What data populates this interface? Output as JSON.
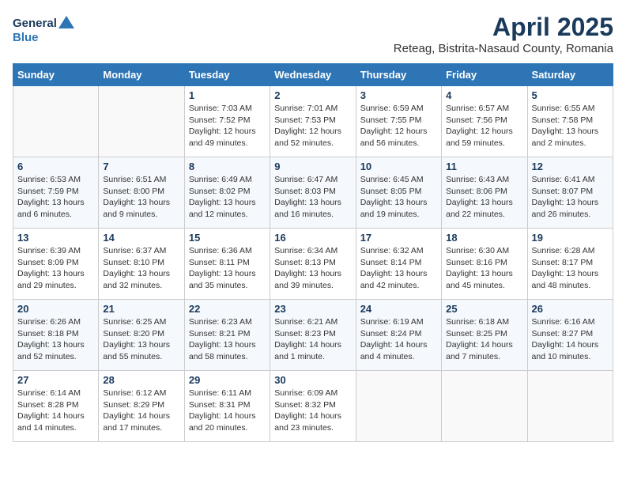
{
  "header": {
    "logo_line1": "General",
    "logo_line2": "Blue",
    "month": "April 2025",
    "location": "Reteag, Bistrita-Nasaud County, Romania"
  },
  "weekdays": [
    "Sunday",
    "Monday",
    "Tuesday",
    "Wednesday",
    "Thursday",
    "Friday",
    "Saturday"
  ],
  "weeks": [
    [
      {
        "day": "",
        "info": ""
      },
      {
        "day": "",
        "info": ""
      },
      {
        "day": "1",
        "info": "Sunrise: 7:03 AM\nSunset: 7:52 PM\nDaylight: 12 hours and 49 minutes."
      },
      {
        "day": "2",
        "info": "Sunrise: 7:01 AM\nSunset: 7:53 PM\nDaylight: 12 hours and 52 minutes."
      },
      {
        "day": "3",
        "info": "Sunrise: 6:59 AM\nSunset: 7:55 PM\nDaylight: 12 hours and 56 minutes."
      },
      {
        "day": "4",
        "info": "Sunrise: 6:57 AM\nSunset: 7:56 PM\nDaylight: 12 hours and 59 minutes."
      },
      {
        "day": "5",
        "info": "Sunrise: 6:55 AM\nSunset: 7:58 PM\nDaylight: 13 hours and 2 minutes."
      }
    ],
    [
      {
        "day": "6",
        "info": "Sunrise: 6:53 AM\nSunset: 7:59 PM\nDaylight: 13 hours and 6 minutes."
      },
      {
        "day": "7",
        "info": "Sunrise: 6:51 AM\nSunset: 8:00 PM\nDaylight: 13 hours and 9 minutes."
      },
      {
        "day": "8",
        "info": "Sunrise: 6:49 AM\nSunset: 8:02 PM\nDaylight: 13 hours and 12 minutes."
      },
      {
        "day": "9",
        "info": "Sunrise: 6:47 AM\nSunset: 8:03 PM\nDaylight: 13 hours and 16 minutes."
      },
      {
        "day": "10",
        "info": "Sunrise: 6:45 AM\nSunset: 8:05 PM\nDaylight: 13 hours and 19 minutes."
      },
      {
        "day": "11",
        "info": "Sunrise: 6:43 AM\nSunset: 8:06 PM\nDaylight: 13 hours and 22 minutes."
      },
      {
        "day": "12",
        "info": "Sunrise: 6:41 AM\nSunset: 8:07 PM\nDaylight: 13 hours and 26 minutes."
      }
    ],
    [
      {
        "day": "13",
        "info": "Sunrise: 6:39 AM\nSunset: 8:09 PM\nDaylight: 13 hours and 29 minutes."
      },
      {
        "day": "14",
        "info": "Sunrise: 6:37 AM\nSunset: 8:10 PM\nDaylight: 13 hours and 32 minutes."
      },
      {
        "day": "15",
        "info": "Sunrise: 6:36 AM\nSunset: 8:11 PM\nDaylight: 13 hours and 35 minutes."
      },
      {
        "day": "16",
        "info": "Sunrise: 6:34 AM\nSunset: 8:13 PM\nDaylight: 13 hours and 39 minutes."
      },
      {
        "day": "17",
        "info": "Sunrise: 6:32 AM\nSunset: 8:14 PM\nDaylight: 13 hours and 42 minutes."
      },
      {
        "day": "18",
        "info": "Sunrise: 6:30 AM\nSunset: 8:16 PM\nDaylight: 13 hours and 45 minutes."
      },
      {
        "day": "19",
        "info": "Sunrise: 6:28 AM\nSunset: 8:17 PM\nDaylight: 13 hours and 48 minutes."
      }
    ],
    [
      {
        "day": "20",
        "info": "Sunrise: 6:26 AM\nSunset: 8:18 PM\nDaylight: 13 hours and 52 minutes."
      },
      {
        "day": "21",
        "info": "Sunrise: 6:25 AM\nSunset: 8:20 PM\nDaylight: 13 hours and 55 minutes."
      },
      {
        "day": "22",
        "info": "Sunrise: 6:23 AM\nSunset: 8:21 PM\nDaylight: 13 hours and 58 minutes."
      },
      {
        "day": "23",
        "info": "Sunrise: 6:21 AM\nSunset: 8:23 PM\nDaylight: 14 hours and 1 minute."
      },
      {
        "day": "24",
        "info": "Sunrise: 6:19 AM\nSunset: 8:24 PM\nDaylight: 14 hours and 4 minutes."
      },
      {
        "day": "25",
        "info": "Sunrise: 6:18 AM\nSunset: 8:25 PM\nDaylight: 14 hours and 7 minutes."
      },
      {
        "day": "26",
        "info": "Sunrise: 6:16 AM\nSunset: 8:27 PM\nDaylight: 14 hours and 10 minutes."
      }
    ],
    [
      {
        "day": "27",
        "info": "Sunrise: 6:14 AM\nSunset: 8:28 PM\nDaylight: 14 hours and 14 minutes."
      },
      {
        "day": "28",
        "info": "Sunrise: 6:12 AM\nSunset: 8:29 PM\nDaylight: 14 hours and 17 minutes."
      },
      {
        "day": "29",
        "info": "Sunrise: 6:11 AM\nSunset: 8:31 PM\nDaylight: 14 hours and 20 minutes."
      },
      {
        "day": "30",
        "info": "Sunrise: 6:09 AM\nSunset: 8:32 PM\nDaylight: 14 hours and 23 minutes."
      },
      {
        "day": "",
        "info": ""
      },
      {
        "day": "",
        "info": ""
      },
      {
        "day": "",
        "info": ""
      }
    ]
  ]
}
